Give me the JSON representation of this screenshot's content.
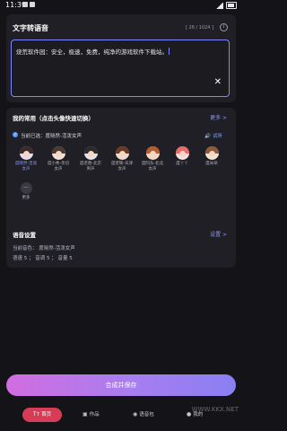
{
  "status_bar": {
    "time": "11:39"
  },
  "tts_card": {
    "title": "文字转语音",
    "counter": "[ 26 / 1024 ]",
    "text": "烧荒软件园：安全，极速，免费，纯净的游戏软件下载站。"
  },
  "favorites": {
    "title": "我的常用（点击头像快速切换）",
    "more_label": "更多 >",
    "selected_text": "当前已选：度晓然-活泼女声",
    "listen_label": "试听",
    "voices": [
      {
        "label": "度晓然-活泼女声",
        "hair_color": "#3a2a2a",
        "bg": "#e7d9f2",
        "active": true
      },
      {
        "label": "度小秀-亲切女声",
        "hair_color": "#4a3a2f",
        "bg": "#f1e1d4",
        "active": false
      },
      {
        "label": "度老爸-北京男声",
        "hair_color": "#2a2a2a",
        "bg": "#e3e3e3",
        "active": false
      },
      {
        "label": "度老铁-天津女声",
        "hair_color": "#6b3a24",
        "bg": "#f0dccb",
        "active": false
      },
      {
        "label": "度阿东-北北女声",
        "hair_color": "#b45d2e",
        "bg": "#f2d8c6",
        "active": false
      },
      {
        "label": "度丫丫",
        "hair_color": "#e96a6a",
        "bg": "#f8e0e0",
        "active": false
      },
      {
        "label": "度米朵",
        "hair_color": "#8c5a3a",
        "bg": "#f4e3d2",
        "active": false
      }
    ],
    "more_item_label": "更多"
  },
  "voice_settings": {
    "title": "语音设置",
    "settings_label": "设置 >",
    "current_voice": "当前音色： 度晓然-活泼女声",
    "params": "语速 5 ； 音调 5 ； 音量 5"
  },
  "synthesize_button": "合成并保存",
  "bottom_nav": {
    "home": "首页",
    "works": "作品",
    "voice_pack": "语音包",
    "mine": "我的"
  },
  "watermark": "WWW.KKX.NET"
}
